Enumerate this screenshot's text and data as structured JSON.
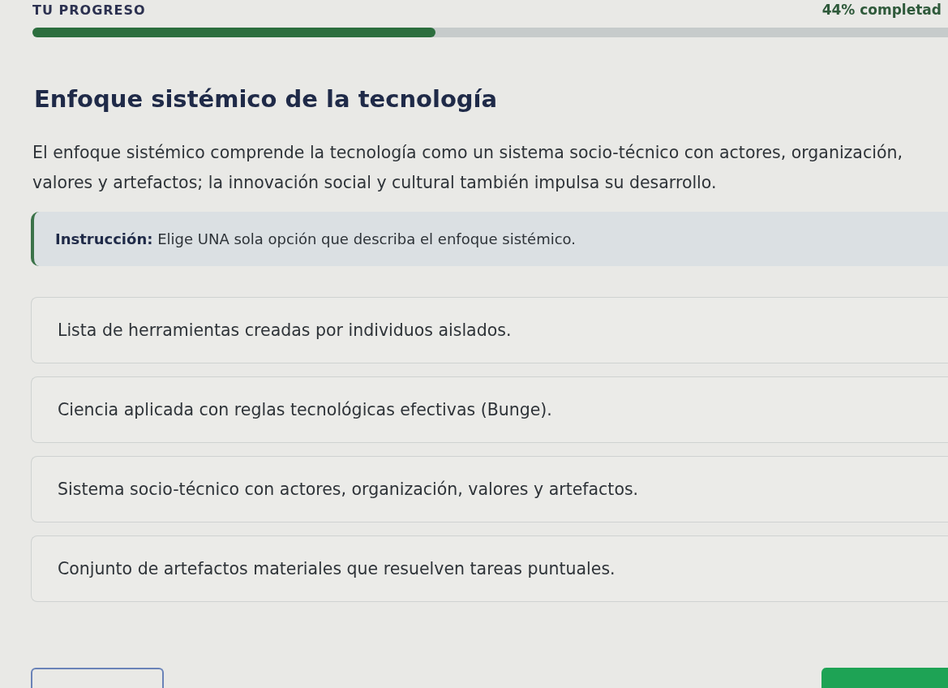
{
  "progress": {
    "label": "TU PROGRESO",
    "reading": "44% completad",
    "level": 0.44
  },
  "title": "Enfoque sistémico de la tecnología",
  "description": "El enfoque sistémico comprende la tecnología como un sistema socio-técnico con actores, organización, valores y artefactos; la innovación social y cultural también impulsa su desarrollo.",
  "instruction": "**Instrucción:** Elige UNA sola opción que describa el enfoque sistémico.",
  "options": [
    {
      "text": "Lista de herramientas creadas por individuos aislados.",
      "selected": false
    },
    {
      "text": "Ciencia aplicada con reglas tecnológicas efectivas (Bunge).",
      "selected": false
    },
    {
      "text": "Sistema socio-técnico con actores, organización, valores y artefactos.",
      "selected": false
    },
    {
      "text": "Conjunto de artefactos materiales que resuelven tareas puntuales.",
      "selected": false
    }
  ],
  "footer_buttons": [
    {
      "kind": "secondary"
    },
    {
      "kind": "primary"
    }
  ]
}
